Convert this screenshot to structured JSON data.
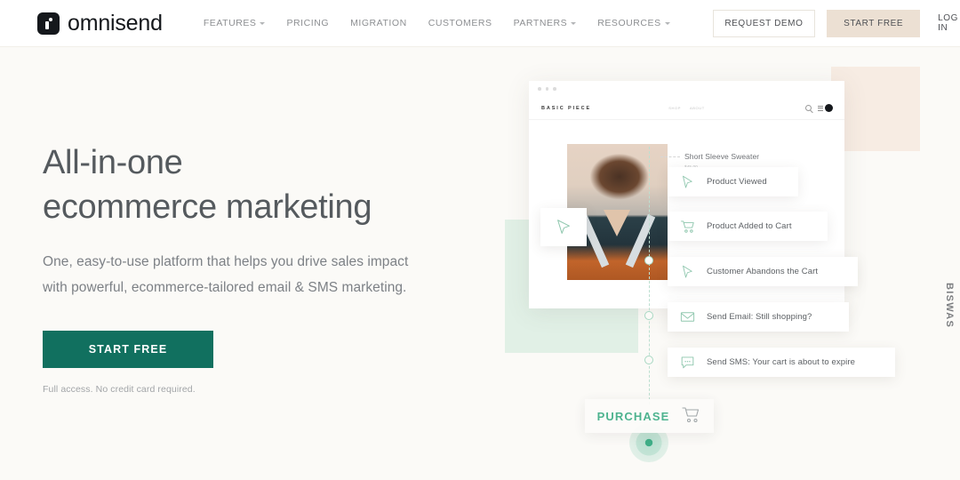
{
  "brand": {
    "name": "omnisend",
    "mark_icon": "omnisend-logo-icon"
  },
  "nav": {
    "items": [
      {
        "label": "FEATURES",
        "has_caret": true
      },
      {
        "label": "PRICING",
        "has_caret": false
      },
      {
        "label": "MIGRATION",
        "has_caret": false
      },
      {
        "label": "CUSTOMERS",
        "has_caret": false
      },
      {
        "label": "PARTNERS",
        "has_caret": true
      },
      {
        "label": "RESOURCES",
        "has_caret": true
      }
    ]
  },
  "header_actions": {
    "request_demo": "REQUEST DEMO",
    "start_free": "START FREE",
    "log_in": "LOG IN"
  },
  "hero": {
    "title_line1": "All-in-one",
    "title_line2": "ecommerce marketing",
    "subtitle": "One, easy-to-use platform that helps you drive sales impact with powerful, ecommerce-tailored email & SMS marketing.",
    "cta_label": "START FREE",
    "note": "Full access. No credit card required."
  },
  "store_mock": {
    "logo": "BASIC PIECE",
    "nav_links": [
      "SHOP",
      "ABOUT"
    ],
    "search_icon": "search-icon",
    "cart_icon": "cart-icon",
    "product_name": "Short Sleeve Sweater",
    "product_price": "$45.00"
  },
  "workflow": {
    "cards": [
      {
        "icon": "cursor-icon",
        "label": "Product Viewed"
      },
      {
        "icon": "cart-icon",
        "label": "Product Added to Cart"
      },
      {
        "icon": "cursor-icon",
        "label": "Customer Abandons the Cart"
      },
      {
        "icon": "envelope-icon",
        "label": "Send Email: Still shopping?"
      },
      {
        "icon": "sms-icon",
        "label": "Send SMS: Your cart is about to expire"
      }
    ],
    "purchase_label": "PURCHASE",
    "purchase_icon": "cart-icon"
  },
  "side_label": "BISWAS",
  "colors": {
    "page_bg": "#fbfaf7",
    "accent_green": "#11705f",
    "pulse_green": "#3fae87",
    "header_cta_beige": "#ece0d3",
    "mint_square": "#d8ece0",
    "peach_square": "#f7ece3"
  }
}
